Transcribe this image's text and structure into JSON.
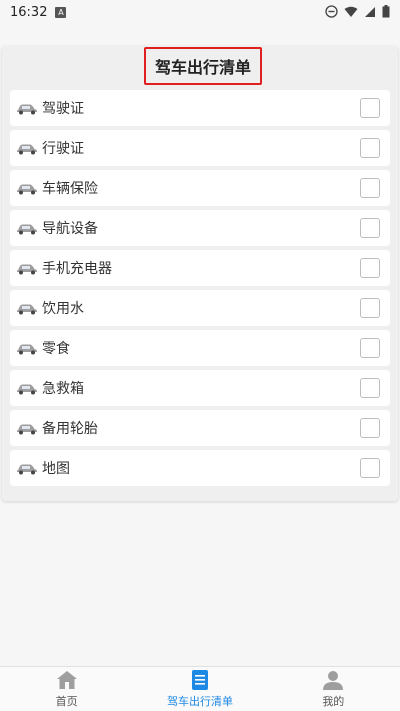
{
  "status": {
    "time": "16:32",
    "badge": "A"
  },
  "title": "驾车出行清单",
  "items": [
    {
      "label": "驾驶证",
      "checked": false
    },
    {
      "label": "行驶证",
      "checked": false
    },
    {
      "label": "车辆保险",
      "checked": false
    },
    {
      "label": "导航设备",
      "checked": false
    },
    {
      "label": "手机充电器",
      "checked": false
    },
    {
      "label": "饮用水",
      "checked": false
    },
    {
      "label": "零食",
      "checked": false
    },
    {
      "label": "急救箱",
      "checked": false
    },
    {
      "label": "备用轮胎",
      "checked": false
    },
    {
      "label": "地图",
      "checked": false
    }
  ],
  "nav": {
    "home": "首页",
    "list": "驾车出行清单",
    "mine": "我的"
  },
  "colors": {
    "accent": "#1e88e5",
    "highlight_border": "#e02020"
  }
}
